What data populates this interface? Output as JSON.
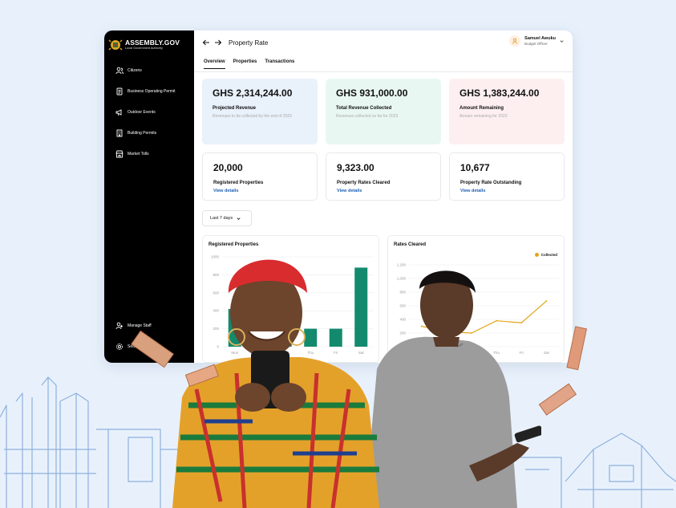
{
  "brand": {
    "name": "ASSEMBLY.GOV",
    "tagline": "Local Government Authority"
  },
  "sidebar": {
    "items": [
      {
        "label": "Citizens",
        "icon": "users-icon"
      },
      {
        "label": "Business Operating Permit",
        "icon": "document-icon"
      },
      {
        "label": "Outdoor Events",
        "icon": "megaphone-icon"
      },
      {
        "label": "Building Permits",
        "icon": "building-icon"
      },
      {
        "label": "Market Tolls",
        "icon": "store-icon"
      }
    ],
    "bottom": [
      {
        "label": "Manage Staff",
        "icon": "staff-icon"
      },
      {
        "label": "Settings",
        "icon": "gear-icon"
      }
    ]
  },
  "header": {
    "title": "Property Rate",
    "user": {
      "name": "Samuel Awuku",
      "role": "Budget Officer"
    }
  },
  "tabs": [
    "Overview",
    "Properties",
    "Transactions"
  ],
  "summary_cards": [
    {
      "amount": "GHS 2,314,244.00",
      "label": "Projected Revenue",
      "note": "Revenues to be collected by the end of 2023",
      "bg": "#e9f1fb"
    },
    {
      "amount": "GHS 931,000.00",
      "label": "Total Revenue Collected",
      "note": "Revenues collected so far for 2023",
      "bg": "#e9f7f2"
    },
    {
      "amount": "GHS 1,383,244.00",
      "label": "Amount Remaining",
      "note": "Arrears remaining for 2023",
      "bg": "#fdeff0"
    }
  ],
  "stat_cards": [
    {
      "value": "20,000",
      "label": "Registered Properties",
      "link": "View details"
    },
    {
      "value": "9,323.00",
      "label": "Property Rates Cleared",
      "link": "View details"
    },
    {
      "value": "10,677",
      "label": "Property Rate Outstanding",
      "link": "View details"
    }
  ],
  "filter": {
    "selected": "Last 7 days"
  },
  "colors": {
    "bar": "#138a6e",
    "line": "#e2a516",
    "link": "#1b5fb3"
  },
  "chart_data": [
    {
      "type": "bar",
      "title": "Registered Properties",
      "categories": [
        "Mon",
        "Tue",
        "Wed",
        "Thu",
        "Fri",
        "Sat"
      ],
      "values": [
        420,
        520,
        380,
        200,
        200,
        880
      ],
      "ylim": [
        0,
        1000
      ],
      "yticks": [
        "0",
        "200",
        "400",
        "600",
        "800",
        "1000"
      ],
      "grid": true
    },
    {
      "type": "line",
      "title": "Rates Cleared",
      "series": [
        {
          "name": "Collected",
          "values": [
            300,
            220,
            200,
            380,
            350,
            670
          ]
        }
      ],
      "categories": [
        "Mon",
        "Tue",
        "Wed",
        "Thu",
        "Fri",
        "Sat"
      ],
      "ylim": [
        0,
        1200
      ],
      "yticks": [
        "0",
        "200",
        "400",
        "600",
        "800",
        "1,000",
        "1,200"
      ],
      "grid": true,
      "legend": "top-right"
    }
  ]
}
